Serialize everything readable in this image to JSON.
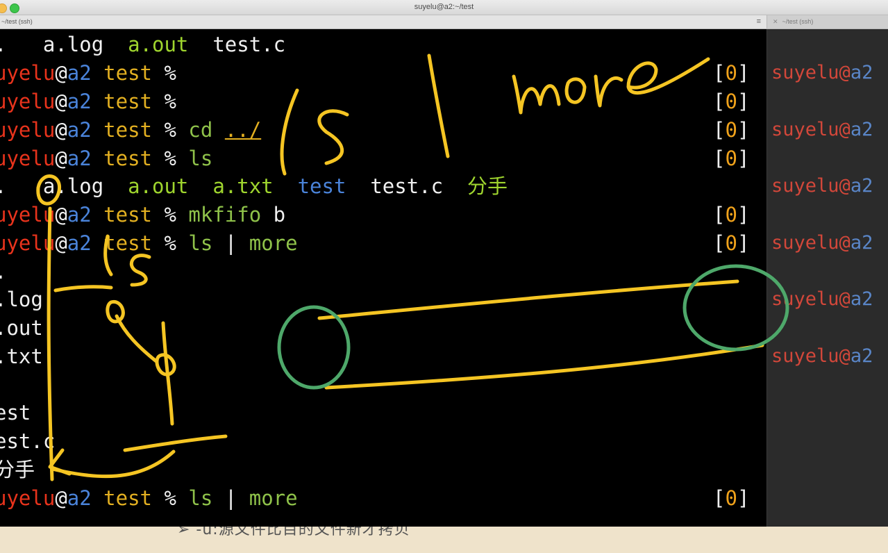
{
  "window": {
    "title": "suyelu@a2:~/test"
  },
  "tabs": [
    {
      "label": "~/test (ssh)"
    },
    {
      "label": "~/test (ssh)"
    }
  ],
  "terminal": {
    "line1": {
      "a": ".",
      "b": "a.log",
      "c": "a.out",
      "d": "test.c"
    },
    "prompt": {
      "user": "suyelu",
      "at": "@",
      "host": "a2",
      "dir": "test",
      "sign": "%"
    },
    "user_cut": "uyelu",
    "status": {
      "open": "[",
      "code": "0",
      "close": "]"
    },
    "cmd_cd": "cd",
    "cmd_cd_arg": "../",
    "cmd_ls": "ls",
    "ls_out": {
      "dot": ".",
      "alog": "a.log",
      "aout": "a.out",
      "atxt": "a.txt",
      "test": "test",
      "testc": "test.c",
      "fenshou": "分手"
    },
    "cmd_mkfifo": "mkfifo",
    "cmd_mkfifo_arg": "b",
    "cmd_pipe": "ls | more",
    "more_out": [
      ".",
      ".log",
      ".out",
      ".txt",
      "",
      "est",
      "est.c",
      "分手"
    ],
    "pipe_word_ls": "ls",
    "pipe_bar": "|",
    "pipe_word_more": "more"
  },
  "side": {
    "user": "suyelu",
    "at": "@",
    "host": "a2"
  },
  "slide": {
    "text": "➢ -u:源文件比目的文件新才拷贝"
  },
  "colors": {
    "user": "#e8331c",
    "host": "#4a83d9",
    "dir": "#e3b021",
    "green": "#9fd52e",
    "ink_yellow": "#f5c523",
    "ink_green": "#4ea86a"
  }
}
